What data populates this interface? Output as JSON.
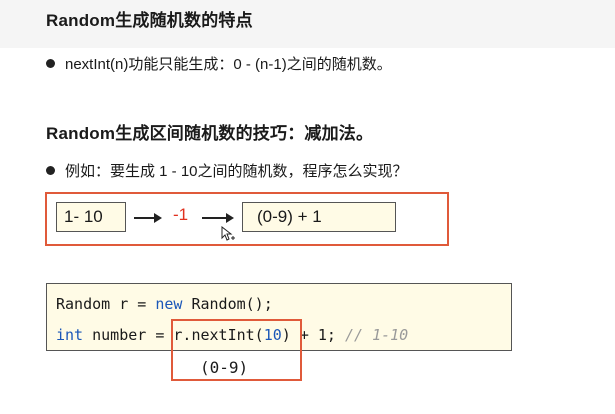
{
  "section1": {
    "title": "Random生成随机数的特点",
    "bullet": "nextInt(n)功能只能生成：0 - (n-1)之间的随机数。"
  },
  "section2": {
    "title": "Random生成区间随机数的技巧：减加法。",
    "bullet": "例如：要生成 1 - 10之间的随机数，程序怎么实现？"
  },
  "example": {
    "range_box": "1- 10",
    "operation": "-1",
    "result_box": "(0-9) + 1",
    "operation_color": "#e0301e",
    "frame_color": "#e05a3a"
  },
  "code": {
    "line1": {
      "pre": "Random r = ",
      "keyword": "new",
      "post": " Random();"
    },
    "line2": {
      "type_keyword": "int",
      "mid": " number = ",
      "call": "r.nextInt(",
      "arg": "10",
      "close": ")",
      "tail": " + 1; ",
      "comment": "// 1-10"
    },
    "highlight_label": "(0-9)"
  }
}
